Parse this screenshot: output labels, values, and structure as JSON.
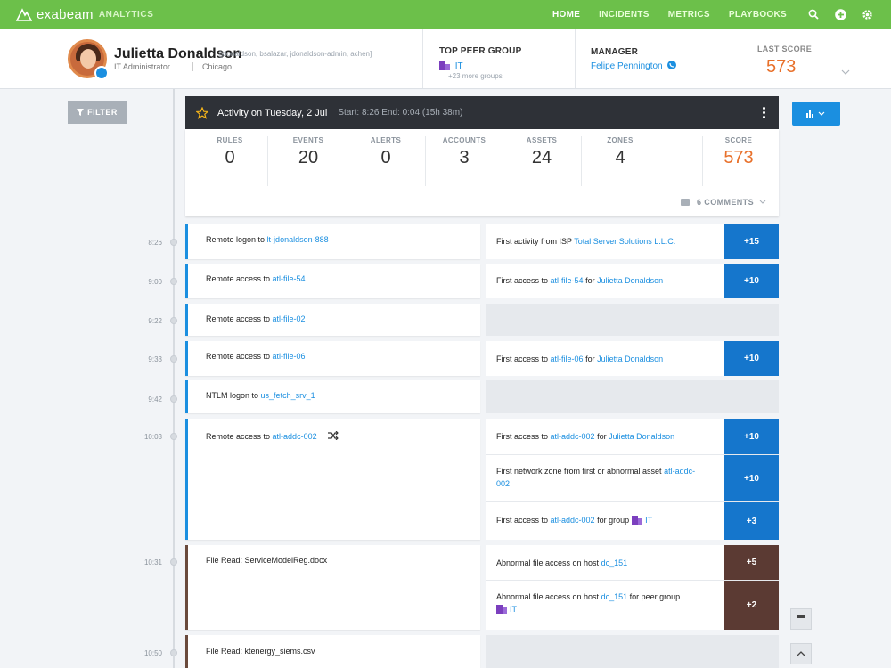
{
  "app": {
    "logo_text": "exabeam",
    "logo_sub": "ANALYTICS",
    "nav": [
      "HOME",
      "INCIDENTS",
      "METRICS",
      "PLAYBOOKS"
    ]
  },
  "profile": {
    "name": "Julietta Donaldson",
    "aliases": "[jdonaldson, bsalazar, jdonaldson-admin, achen]",
    "title": "IT Administrator",
    "location": "Chicago",
    "peer_group_label": "TOP PEER GROUP",
    "peer_group_value": "IT",
    "peer_group_more": "+23 more groups",
    "manager_label": "MANAGER",
    "manager_value": "Felipe Pennington",
    "last_score_label": "LAST SCORE",
    "last_score_value": "573"
  },
  "filter_label": "FILTER",
  "activity": {
    "title": "Activity on Tuesday, 2 Jul",
    "range": "Start: 8:26 End: 0:04 (15h 38m)",
    "stats": [
      {
        "label": "RULES",
        "value": "0"
      },
      {
        "label": "EVENTS",
        "value": "20"
      },
      {
        "label": "ALERTS",
        "value": "0"
      },
      {
        "label": "ACCOUNTS",
        "value": "3"
      },
      {
        "label": "ASSETS",
        "value": "24"
      },
      {
        "label": "ZONES",
        "value": "4"
      },
      {
        "label": "SCORE",
        "value": "573"
      }
    ],
    "comments": "6 COMMENTS"
  },
  "events": [
    {
      "time": "8:26",
      "text": "Remote logon to",
      "link": "lt-jdonaldson-888"
    },
    {
      "time": "9:00",
      "text": "Remote access to",
      "link": "atl-file-54"
    },
    {
      "time": "9:22",
      "text": "Remote access to",
      "link": "atl-file-02"
    },
    {
      "time": "9:33",
      "text": "Remote access to",
      "link": "atl-file-06"
    },
    {
      "time": "9:42",
      "text": "NTLM logon to",
      "link": "us_fetch_srv_1"
    },
    {
      "time": "10:03",
      "text": "Remote access to",
      "link": "atl-addc-002"
    },
    {
      "time": "10:31",
      "text": "File Read: ServiceModelReg.docx",
      "link": ""
    },
    {
      "time": "10:50",
      "text": "File Read: ktenergy_siems.csv",
      "link": ""
    }
  ],
  "rules": [
    {
      "pre": "First activity from ISP",
      "link": "Total Server Solutions L.L.C.",
      "mid": "",
      "link2": "",
      "points": "+15"
    },
    {
      "pre": "First access to",
      "link": "atl-file-54",
      "mid": "for",
      "link2": "Julietta Donaldson",
      "points": "+10"
    },
    {
      "pre": "First access to",
      "link": "atl-file-06",
      "mid": "for",
      "link2": "Julietta Donaldson",
      "points": "+10"
    },
    {
      "pre": "First access to",
      "link": "atl-addc-002",
      "mid": "for",
      "link2": "Julietta Donaldson",
      "points": "+10"
    },
    {
      "pre": "First network zone from first or abnormal asset",
      "link": "atl-addc-002",
      "mid": "",
      "link2": "",
      "points": "+10"
    },
    {
      "pre": "First access to",
      "link": "atl-addc-002",
      "mid": "for group",
      "link2": "IT",
      "points": "+3"
    },
    {
      "pre": "Abnormal file access on host",
      "link": "dc_151",
      "mid": "",
      "link2": "",
      "points": "+5"
    },
    {
      "pre": "Abnormal file access on host",
      "link": "dc_151",
      "mid": "for peer group",
      "link2": "IT",
      "points": "+2"
    }
  ],
  "icons": [
    "exabeam-logo-icon",
    "search-icon",
    "add-icon",
    "settings-icon",
    "star-icon",
    "more-icon",
    "bar-chart-icon",
    "calendar-icon",
    "chevron-up-icon",
    "shuffle-icon",
    "building-icon",
    "phone-icon",
    "comment-icon",
    "filter-icon"
  ],
  "colors": {
    "brand_green": "#6cc04a",
    "link_blue": "#1b8fe0",
    "score_orange": "#e8702a",
    "points_blue": "#1576cc",
    "points_brown": "#5b3a33"
  }
}
